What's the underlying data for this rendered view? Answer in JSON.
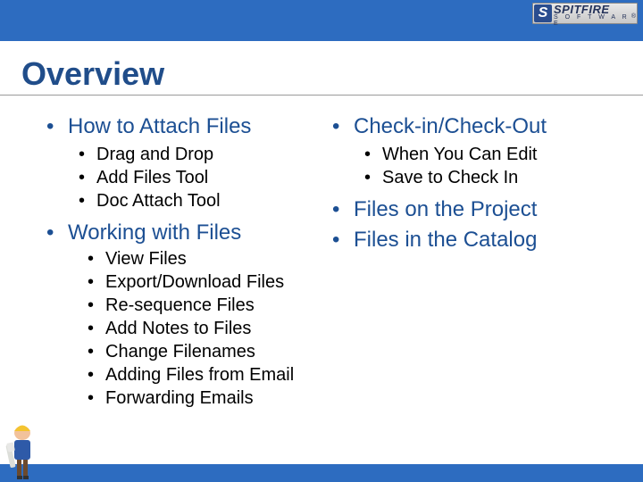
{
  "brand": {
    "name": "SPITFIRE",
    "sub": "S O F T W A R E",
    "mark": "S",
    "reg": "®"
  },
  "title": "Overview",
  "left": {
    "attach": {
      "heading": "How to Attach Files",
      "items": [
        "Drag and Drop",
        "Add Files Tool",
        "Doc Attach Tool"
      ]
    },
    "working": {
      "heading": "Working with Files",
      "items": [
        "View Files",
        "Export/Download Files",
        "Re-sequence Files",
        "Add Notes to Files",
        "Change Filenames",
        "Adding Files from Email",
        "Forwarding Emails"
      ]
    }
  },
  "right": {
    "checkin": {
      "heading": "Check-in/Check-Out",
      "items": [
        "When You Can Edit",
        "Save to Check In"
      ]
    },
    "project": {
      "heading": "Files on the Project"
    },
    "catalog": {
      "heading": "Files in the Catalog"
    }
  }
}
